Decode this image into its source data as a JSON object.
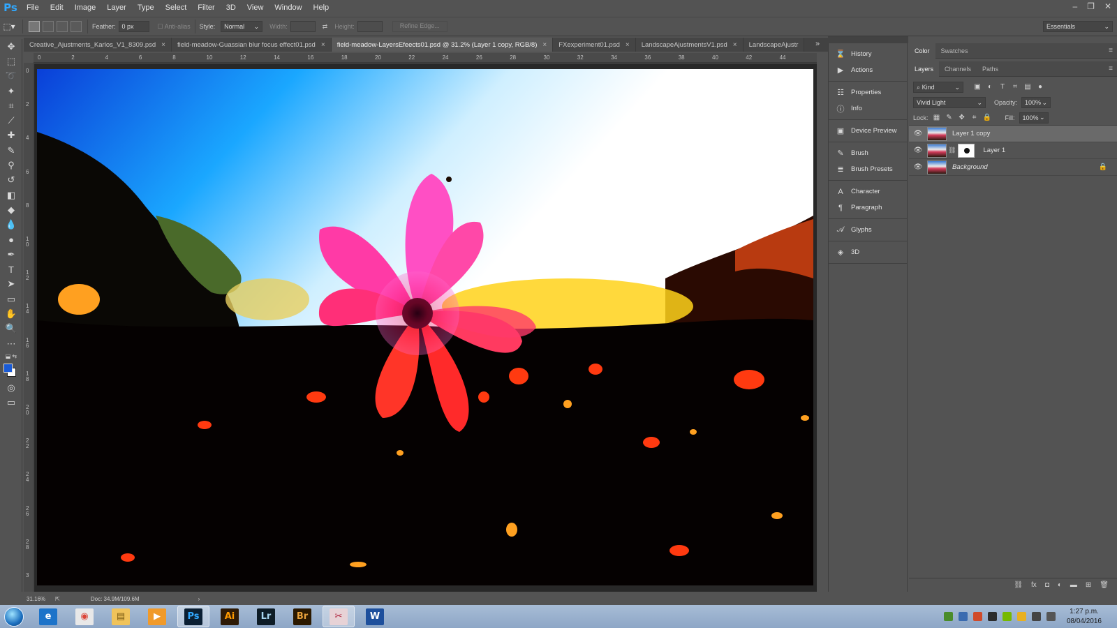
{
  "app": {
    "logo": "Ps",
    "menu": [
      "File",
      "Edit",
      "Image",
      "Layer",
      "Type",
      "Select",
      "Filter",
      "3D",
      "View",
      "Window",
      "Help"
    ],
    "window_controls": [
      "–",
      "❐",
      "✕"
    ]
  },
  "options_bar": {
    "feather_label": "Feather:",
    "feather_value": "0 px",
    "antialias_label": "Anti-alias",
    "style_label": "Style:",
    "style_value": "Normal",
    "width_label": "Width:",
    "height_label": "Height:",
    "refine_edge": "Refine Edge...",
    "workspace": "Essentials"
  },
  "document_tabs": [
    {
      "label": "Creative_Ajustments_Karlos_V1_8309.psd",
      "active": false
    },
    {
      "label": "field-meadow-Guassian blur focus effect01.psd",
      "active": false
    },
    {
      "label": "field-meadow-LayersEfeects01.psd @ 31.2% (Layer 1 copy, RGB/8)",
      "active": true
    },
    {
      "label": "FXexperiment01.psd",
      "active": false
    },
    {
      "label": "LandscapeAjustmentsV1.psd",
      "active": false
    },
    {
      "label": "LandscapeAjustr",
      "active": false
    }
  ],
  "ruler_top": [
    "0",
    "2",
    "4",
    "6",
    "8",
    "10",
    "12",
    "14",
    "16",
    "18",
    "20",
    "22",
    "24",
    "26",
    "28",
    "30",
    "32",
    "34",
    "36",
    "38",
    "40",
    "42",
    "44"
  ],
  "ruler_left": [
    "0",
    "2",
    "4",
    "6",
    "8",
    "1 0",
    "1 2",
    "1 4",
    "1 6",
    "1 8",
    "2 0",
    "2 2",
    "2 4",
    "2 6",
    "2 8",
    "3"
  ],
  "status": {
    "zoom": "31.16%",
    "doc": "Doc: 34.9M/109.6M"
  },
  "mid_panel": [
    [
      {
        "icon": "history-icon",
        "glyph": "⌛",
        "label": "History"
      },
      {
        "icon": "actions-icon",
        "glyph": "▶",
        "label": "Actions"
      }
    ],
    [
      {
        "icon": "properties-icon",
        "glyph": "☷",
        "label": "Properties"
      },
      {
        "icon": "info-icon",
        "glyph": "ⓘ",
        "label": "Info"
      }
    ],
    [
      {
        "icon": "device-preview-icon",
        "glyph": "▣",
        "label": "Device Preview"
      }
    ],
    [
      {
        "icon": "brush-icon",
        "glyph": "✎",
        "label": "Brush"
      },
      {
        "icon": "brush-presets-icon",
        "glyph": "≣",
        "label": "Brush Presets"
      }
    ],
    [
      {
        "icon": "character-icon",
        "glyph": "A",
        "label": "Character"
      },
      {
        "icon": "paragraph-icon",
        "glyph": "¶",
        "label": "Paragraph"
      }
    ],
    [
      {
        "icon": "glyphs-icon",
        "glyph": "𝒜",
        "label": "Glyphs"
      }
    ],
    [
      {
        "icon": "3d-icon",
        "glyph": "◈",
        "label": "3D"
      }
    ]
  ],
  "color_panel": {
    "tabs": [
      "Color",
      "Swatches"
    ]
  },
  "layers_panel": {
    "tabs": [
      "Layers",
      "Channels",
      "Paths"
    ],
    "kind_label": "Kind",
    "blend_mode": "Vivid Light",
    "opacity_label": "Opacity:",
    "opacity_value": "100%",
    "lock_label": "Lock:",
    "fill_label": "Fill:",
    "fill_value": "100%",
    "layers": [
      {
        "name": "Layer 1 copy",
        "selected": true,
        "mask": false,
        "locked": false,
        "italic": false
      },
      {
        "name": "Layer 1",
        "selected": false,
        "mask": true,
        "locked": false,
        "italic": false
      },
      {
        "name": "Background",
        "selected": false,
        "mask": false,
        "locked": true,
        "italic": true
      }
    ]
  },
  "taskbar": {
    "apps": [
      {
        "name": "internet-explorer",
        "glyph": "e",
        "bg": "#1c73c9",
        "color": "#ffffff",
        "active": false
      },
      {
        "name": "chrome",
        "glyph": "◉",
        "bg": "#e8e8e8",
        "color": "#db4437",
        "active": false
      },
      {
        "name": "file-explorer",
        "glyph": "▤",
        "bg": "#f0c35a",
        "color": "#7a5a12",
        "active": false
      },
      {
        "name": "media-player",
        "glyph": "▶",
        "bg": "#f09a2a",
        "color": "#ffffff",
        "active": false
      },
      {
        "name": "photoshop",
        "glyph": "Ps",
        "bg": "#0b1f33",
        "color": "#31a8ff",
        "active": true
      },
      {
        "name": "illustrator",
        "glyph": "Ai",
        "bg": "#2e1a05",
        "color": "#ff9a00",
        "active": false
      },
      {
        "name": "lightroom",
        "glyph": "Lr",
        "bg": "#0d1c26",
        "color": "#a9d6ef",
        "active": false
      },
      {
        "name": "bridge",
        "glyph": "Br",
        "bg": "#2b1900",
        "color": "#e9a23b",
        "active": false
      },
      {
        "name": "snipping-tool",
        "glyph": "✂",
        "bg": "#e7d2d6",
        "color": "#b0263f",
        "active": true
      },
      {
        "name": "word",
        "glyph": "W",
        "bg": "#1d4f9c",
        "color": "#ffffff",
        "active": false
      }
    ],
    "time": "1:27 p.m.",
    "date": "08/04/2016"
  },
  "colors": {
    "foreground": "#1a5bd6",
    "background": "#ffffff",
    "accent": "#31a8ff"
  }
}
